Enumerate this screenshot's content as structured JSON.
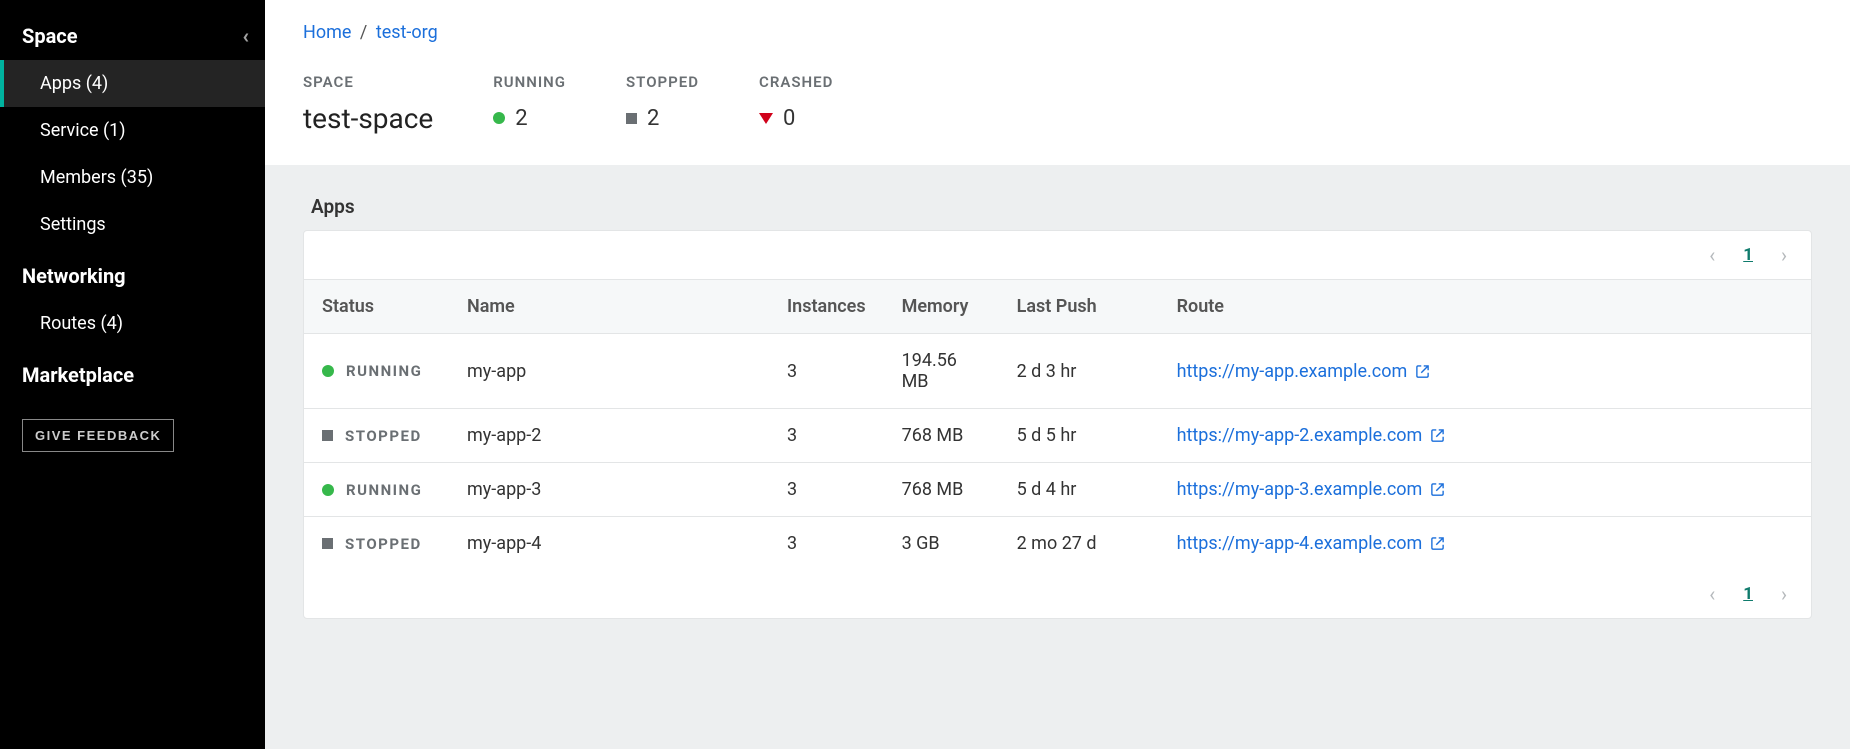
{
  "sidebar": {
    "sections": [
      {
        "title": "Space",
        "items": [
          {
            "label": "Apps (4)",
            "active": true
          },
          {
            "label": "Service (1)",
            "active": false
          },
          {
            "label": "Members (35)",
            "active": false
          },
          {
            "label": "Settings",
            "active": false
          }
        ]
      },
      {
        "title": "Networking",
        "items": [
          {
            "label": "Routes (4)",
            "active": false
          }
        ]
      },
      {
        "title": "Marketplace",
        "items": []
      }
    ],
    "feedback_label": "GIVE FEEDBACK"
  },
  "breadcrumb": {
    "home_label": "Home",
    "org_label": "test-org"
  },
  "stats": {
    "space_label": "SPACE",
    "space_name": "test-space",
    "running_label": "RUNNING",
    "running_count": "2",
    "stopped_label": "STOPPED",
    "stopped_count": "2",
    "crashed_label": "CRASHED",
    "crashed_count": "0"
  },
  "apps": {
    "panel_title": "Apps",
    "columns": {
      "status": "Status",
      "name": "Name",
      "instances": "Instances",
      "memory": "Memory",
      "last_push": "Last Push",
      "route": "Route"
    },
    "rows": [
      {
        "status": "RUNNING",
        "name": "my-app",
        "instances": "3",
        "memory": "194.56 MB",
        "last_push": "2 d 3 hr",
        "route": "https://my-app.example.com"
      },
      {
        "status": "STOPPED",
        "name": "my-app-2",
        "instances": "3",
        "memory": "768 MB",
        "last_push": "5 d 5 hr",
        "route": "https://my-app-2.example.com"
      },
      {
        "status": "RUNNING",
        "name": "my-app-3",
        "instances": "3",
        "memory": "768 MB",
        "last_push": "5 d 4 hr",
        "route": "https://my-app-3.example.com"
      },
      {
        "status": "STOPPED",
        "name": "my-app-4",
        "instances": "3",
        "memory": "3 GB",
        "last_push": "2 mo 27 d",
        "route": "https://my-app-4.example.com"
      }
    ],
    "page": "1"
  },
  "colors": {
    "accent_link": "#1b6fdb",
    "teal": "#0f7b6c",
    "running": "#36b84b",
    "stopped": "#6a6f73",
    "crashed": "#d0021b"
  }
}
